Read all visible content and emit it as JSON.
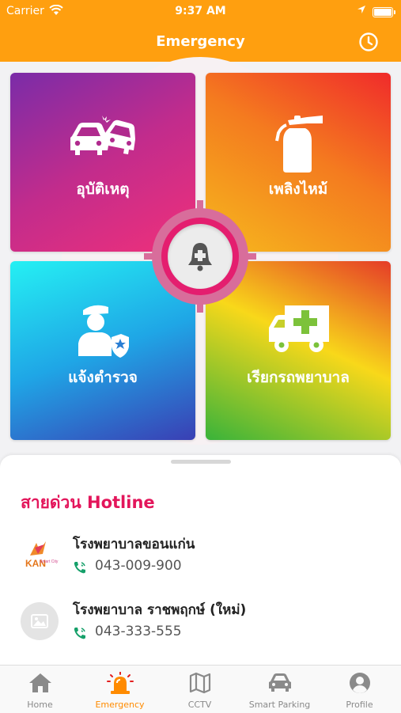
{
  "status_bar": {
    "carrier": "Carrier",
    "time": "9:37 AM"
  },
  "header": {
    "title": "Emergency",
    "history_icon": "clock-icon"
  },
  "tiles": [
    {
      "label": "อุบัติเหตุ",
      "icon": "car-crash-icon"
    },
    {
      "label": "เพลิงไหม้",
      "icon": "fire-extinguisher-icon"
    },
    {
      "label": "แจ้งตำรวจ",
      "icon": "police-officer-icon"
    },
    {
      "label": "เรียกรถพยาบาล",
      "icon": "ambulance-icon"
    }
  ],
  "center_button": {
    "icon": "alarm-bell-plus-icon"
  },
  "hotline": {
    "title": "สายด่วน Hotline",
    "contacts": [
      {
        "name": "โรงพยาบาลขอนแก่น",
        "phone": "043-009-900",
        "logo_text": "KAN",
        "logo_sub": "Smart City"
      },
      {
        "name": "โรงพยาบาล ราชพฤกษ์ (ใหม่)",
        "phone": "043-333-555"
      }
    ]
  },
  "tabbar": {
    "items": [
      {
        "label": "Home",
        "icon": "home-icon"
      },
      {
        "label": "Emergency",
        "icon": "siren-icon",
        "active": true
      },
      {
        "label": "CCTV",
        "icon": "map-icon"
      },
      {
        "label": "Smart Parking",
        "icon": "car-icon"
      },
      {
        "label": "Profile",
        "icon": "user-icon"
      }
    ]
  },
  "colors": {
    "brand_orange": "#ff9f0f",
    "hotline_pink": "#e3165b",
    "phone_green": "#16a06a"
  }
}
